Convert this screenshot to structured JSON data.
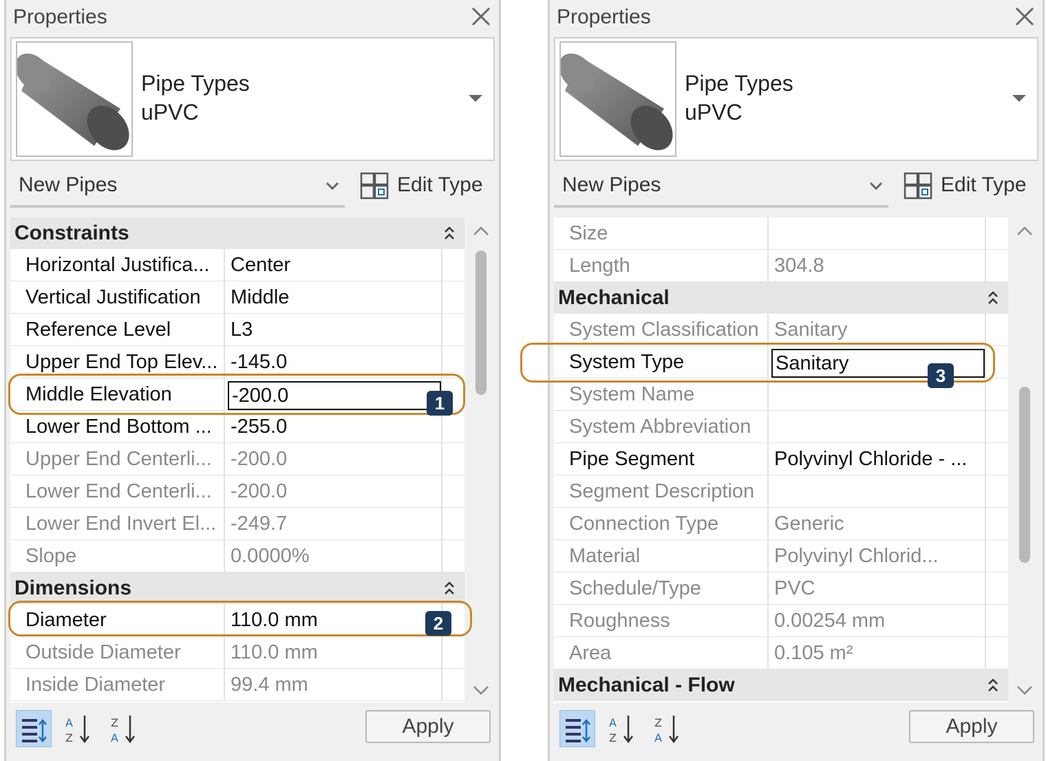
{
  "left": {
    "title": "Properties",
    "type_family": "Pipe Types",
    "type_name": "uPVC",
    "instance_filter": "New Pipes",
    "edit_type": "Edit Type",
    "groups": [
      {
        "label": "Constraints"
      },
      {
        "label": "Dimensions"
      }
    ],
    "rows": [
      {
        "name": "Horizontal Justifica...",
        "value": "Center"
      },
      {
        "name": "Vertical Justification",
        "value": "Middle"
      },
      {
        "name": "Reference Level",
        "value": "L3"
      },
      {
        "name": "Upper End Top Elev...",
        "value": "-145.0"
      },
      {
        "name": "Middle Elevation",
        "value": "-200.0"
      },
      {
        "name": "Lower End Bottom ...",
        "value": "-255.0"
      },
      {
        "name": "Upper End Centerli...",
        "value": "-200.0"
      },
      {
        "name": "Lower End Centerli...",
        "value": "-200.0"
      },
      {
        "name": "Lower End Invert El...",
        "value": "-249.7"
      },
      {
        "name": "Slope",
        "value": "0.0000%"
      },
      {
        "name": "Diameter",
        "value": "110.0 mm"
      },
      {
        "name": "Outside Diameter",
        "value": "110.0 mm"
      },
      {
        "name": "Inside Diameter",
        "value": "99.4 mm"
      }
    ],
    "apply": "Apply",
    "badges": [
      "1",
      "2"
    ]
  },
  "right": {
    "title": "Properties",
    "type_family": "Pipe Types",
    "type_name": "uPVC",
    "instance_filter": "New Pipes",
    "edit_type": "Edit Type",
    "groups": [
      {
        "label": "Mechanical"
      },
      {
        "label": "Mechanical - Flow"
      }
    ],
    "rows": [
      {
        "name": "Size",
        "value": ""
      },
      {
        "name": "Length",
        "value": "304.8"
      },
      {
        "name": "System Classification",
        "value": "Sanitary"
      },
      {
        "name": "System Type",
        "value": "Sanitary"
      },
      {
        "name": "System Name",
        "value": ""
      },
      {
        "name": "System Abbreviation",
        "value": ""
      },
      {
        "name": "Pipe Segment",
        "value": "Polyvinyl Chloride - ..."
      },
      {
        "name": "Segment Description",
        "value": ""
      },
      {
        "name": "Connection Type",
        "value": "Generic"
      },
      {
        "name": "Material",
        "value": "Polyvinyl Chlorid..."
      },
      {
        "name": "Schedule/Type",
        "value": "PVC"
      },
      {
        "name": "Roughness",
        "value": "0.00254 mm"
      },
      {
        "name": "Area",
        "value": "0.105 m²"
      }
    ],
    "apply": "Apply",
    "badges": [
      "3"
    ]
  },
  "colors": {
    "callout": "#c9872a",
    "badge": "#1d3a5c",
    "sort_active": "#bcd8f2"
  },
  "icons": [
    "close-icon",
    "pipe-thumbnail",
    "chevron-down-icon",
    "edit-type-icon",
    "collapse-icon",
    "scroll-up-icon",
    "scroll-down-icon",
    "sort-by-category-icon",
    "sort-az-icon",
    "sort-za-icon"
  ]
}
